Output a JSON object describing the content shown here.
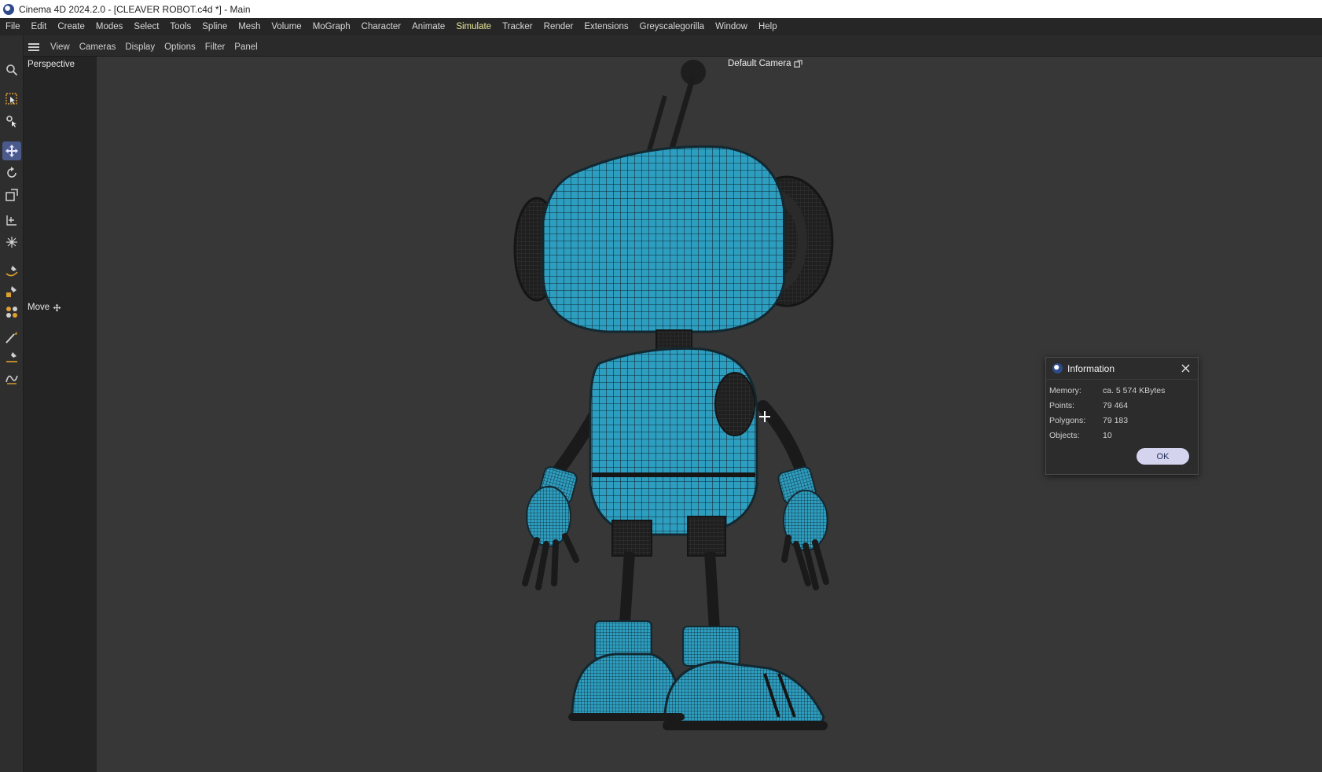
{
  "window": {
    "title": "Cinema 4D 2024.2.0 - [CLEAVER ROBOT.c4d *] - Main"
  },
  "menubar": {
    "items": [
      "File",
      "Edit",
      "Create",
      "Modes",
      "Select",
      "Tools",
      "Spline",
      "Mesh",
      "Volume",
      "MoGraph",
      "Character",
      "Animate",
      "Simulate",
      "Tracker",
      "Render",
      "Extensions",
      "Greyscalegorilla",
      "Window",
      "Help"
    ],
    "highlighted": "Simulate"
  },
  "viewbar": {
    "items": [
      "View",
      "Cameras",
      "Display",
      "Options",
      "Filter",
      "Panel"
    ]
  },
  "viewport": {
    "label": "Perspective",
    "camera": "Default Camera",
    "tool_hint": "Move",
    "model_color": "#2e9ec0"
  },
  "toolbar": {
    "tools": [
      "search-icon",
      "live-selection-icon",
      "tweak-icon",
      "move-icon",
      "rotate-icon",
      "scale-icon",
      "axis-icon",
      "transform-icon",
      "spline-pen-icon",
      "spline-sketch-icon",
      "spline-smooth-icon",
      "brush-icon",
      "spline-arc-icon",
      "spline-draw-icon"
    ],
    "active": "move-icon"
  },
  "dialog": {
    "title": "Information",
    "rows": [
      {
        "label": "Memory:",
        "value": "ca. 5 574 KBytes"
      },
      {
        "label": "Points:",
        "value": "79 464"
      },
      {
        "label": "Polygons:",
        "value": "79 183"
      },
      {
        "label": "Objects:",
        "value": "10"
      }
    ],
    "ok_label": "OK"
  }
}
